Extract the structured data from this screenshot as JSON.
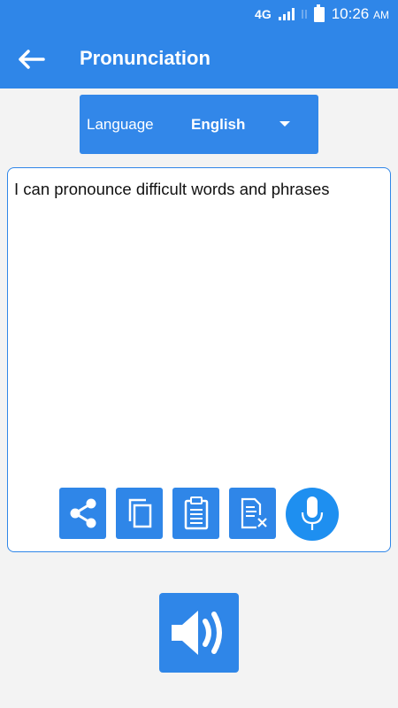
{
  "status_bar": {
    "network": "4G",
    "time": "10:26",
    "ampm": "AM"
  },
  "app_bar": {
    "title": "Pronunciation"
  },
  "language": {
    "label": "Language",
    "value": "English"
  },
  "editor": {
    "text": "I can pronounce difficult words and phrases"
  },
  "colors": {
    "primary": "#2f86e8",
    "background": "#f3f3f3"
  },
  "icons": {
    "share": "share-icon",
    "copy": "copy-icon",
    "paste": "clipboard-icon",
    "clear": "clear-text-icon",
    "mic": "microphone-icon",
    "speaker": "speaker-icon",
    "back": "arrow-left-icon"
  }
}
